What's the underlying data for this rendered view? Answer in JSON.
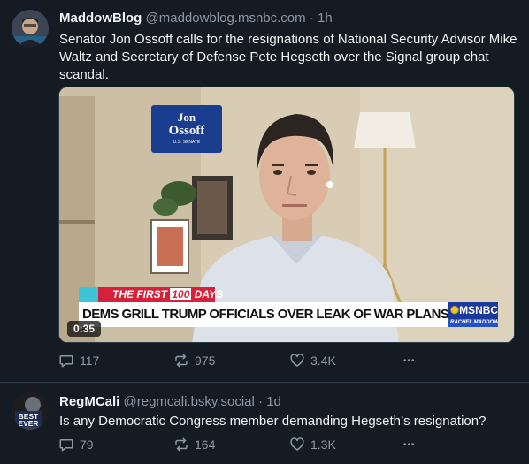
{
  "posts": [
    {
      "author": {
        "display_name": "MaddowBlog",
        "handle": "@maddowblog.msnbc.com",
        "separator": "·",
        "time": "1h"
      },
      "text": "Senator Jon Ossoff calls for the resignations of National Security Advisor Mike Waltz and Secretary of Defense Pete Hegseth over the Signal group chat scandal.",
      "video": {
        "duration": "0:35",
        "sign": {
          "line1": "Jon",
          "line2": "Ossoff",
          "line3": "U.S. SENATE"
        },
        "lower_third": {
          "banner_prefix": "THE FIRST",
          "banner_number": "100",
          "banner_suffix": "DAYS",
          "headline": "DEMS GRILL TRUMP OFFICIALS OVER LEAK OF WAR PLANS",
          "network": "MSNBC",
          "show": "RACHEL MADDOW"
        }
      },
      "actions": {
        "replies": "117",
        "reposts": "975",
        "likes": "3.4K",
        "more": "•••"
      }
    },
    {
      "author": {
        "display_name": "RegMCali",
        "handle": "@regmcali.bsky.social",
        "separator": "·",
        "time": "1d"
      },
      "avatar_text": {
        "line1": "BEST",
        "line2": "EVER"
      },
      "text": "Is any Democratic Congress member demanding Hegseth’s resignation?",
      "actions": {
        "replies": "79",
        "reposts": "164",
        "likes": "1.3K",
        "more": "•••"
      }
    }
  ],
  "colors": {
    "background": "#141b23",
    "text_primary": "#f1f3f5",
    "text_secondary": "#8b98a5",
    "divider": "#2e3a47",
    "msnbc_blue": "#1b3a9c",
    "banner_red": "#d6213b",
    "banner_cyan": "#3cc4d9"
  },
  "icons": [
    "reply-icon",
    "repost-icon",
    "like-icon",
    "more-icon"
  ]
}
